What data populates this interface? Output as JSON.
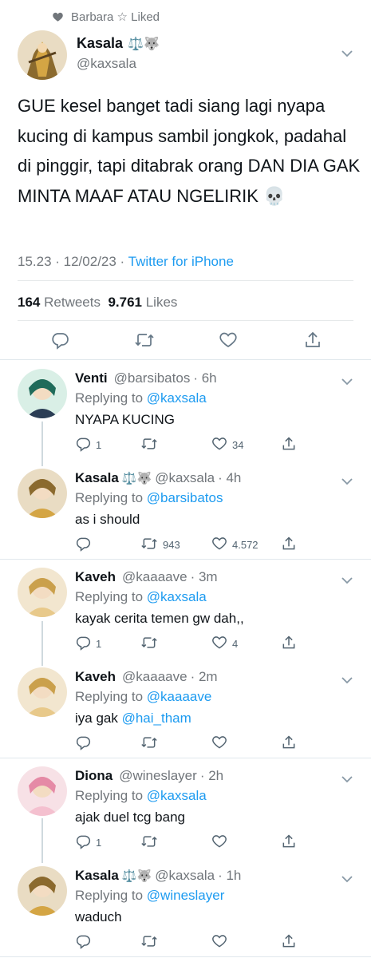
{
  "social_context": {
    "text": "Barbara ☆ Liked"
  },
  "main_tweet": {
    "name": "Kasala",
    "emoji": "⚖️🐺",
    "handle": "@kaxsala",
    "text": "GUE kesel banget tadi siang lagi nyapa kucing di kampus sambil jongkok, padahal di pinggir, tapi ditabrak orang DAN DIA GAK MINTA MAAF ATAU NGELIRIK 💀",
    "time": "15.23 · 12/02/23 · ",
    "source": "Twitter for iPhone",
    "retweets_count": "164",
    "retweets_label": "Retweets",
    "likes_count": "9.761",
    "likes_label": "Likes"
  },
  "replies": [
    {
      "name": "Venti",
      "emoji": "",
      "handle": "@barsibatos",
      "time": "· 6h",
      "replying_label": "Replying to",
      "replying_to": "@kaxsala",
      "text": "NYAPA KUCING",
      "text_mention": "",
      "reply_count": "1",
      "retweet_count": "",
      "like_count": "34"
    },
    {
      "name": "Kasala",
      "emoji": "⚖️🐺",
      "handle": "@kaxsala",
      "time": "· 4h",
      "replying_label": "Replying to",
      "replying_to": "@barsibatos",
      "text": "as i should",
      "text_mention": "",
      "reply_count": "",
      "retweet_count": "943",
      "like_count": "4.572"
    },
    {
      "name": "Kaveh",
      "emoji": "",
      "handle": "@kaaaave",
      "time": "· 3m",
      "replying_label": "Replying to",
      "replying_to": "@kaxsala",
      "text": "kayak cerita temen gw dah,,",
      "text_mention": "",
      "reply_count": "1",
      "retweet_count": "",
      "like_count": "4"
    },
    {
      "name": "Kaveh",
      "emoji": "",
      "handle": "@kaaaave",
      "time": "· 2m",
      "replying_label": "Replying to",
      "replying_to": "@kaaaave",
      "text": "iya gak ",
      "text_mention": "@hai_tham",
      "reply_count": "",
      "retweet_count": "",
      "like_count": ""
    },
    {
      "name": "Diona",
      "emoji": "",
      "handle": "@wineslayer",
      "time": "· 2h",
      "replying_label": "Replying to",
      "replying_to": "@kaxsala",
      "text": "ajak duel tcg bang",
      "text_mention": "",
      "reply_count": "1",
      "retweet_count": "",
      "like_count": ""
    },
    {
      "name": "Kasala",
      "emoji": "⚖️🐺",
      "handle": "@kaxsala",
      "time": "· 1h",
      "replying_label": "Replying to",
      "replying_to": "@wineslayer",
      "text": "waduch",
      "text_mention": "",
      "reply_count": "",
      "retweet_count": "",
      "like_count": ""
    }
  ],
  "colors": {
    "accent": "#1d9bf0",
    "text": "#0f1419",
    "secondary": "#71767b",
    "divider": "#e1e8ed"
  }
}
